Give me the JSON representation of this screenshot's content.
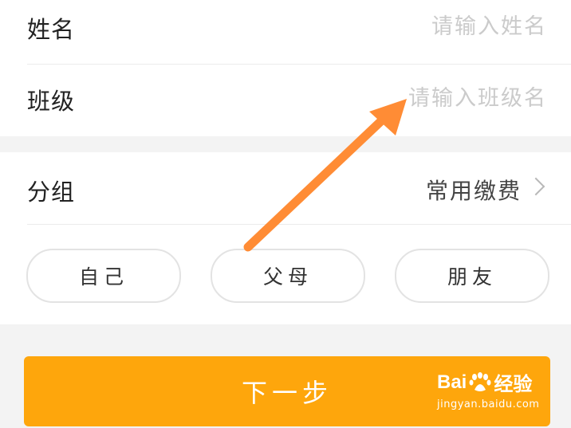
{
  "form": {
    "name_label": "姓名",
    "name_placeholder": "请输入姓名",
    "class_label": "班级",
    "class_placeholder": "请输入班级名",
    "group_label": "分组",
    "group_value": "常用缴费"
  },
  "chips": [
    "自己",
    "父母",
    "朋友"
  ],
  "next_button": "下一步",
  "watermark": {
    "brand_left": "Bai",
    "brand_right": "经验",
    "url": "jingyan.baidu.com"
  },
  "colors": {
    "accent": "#fea60c",
    "arrow": "#ff8c35",
    "page_bg": "#f3f3f3"
  },
  "icons": [
    "chevron-right-icon",
    "baidu-paw-icon",
    "annotation-arrow"
  ]
}
